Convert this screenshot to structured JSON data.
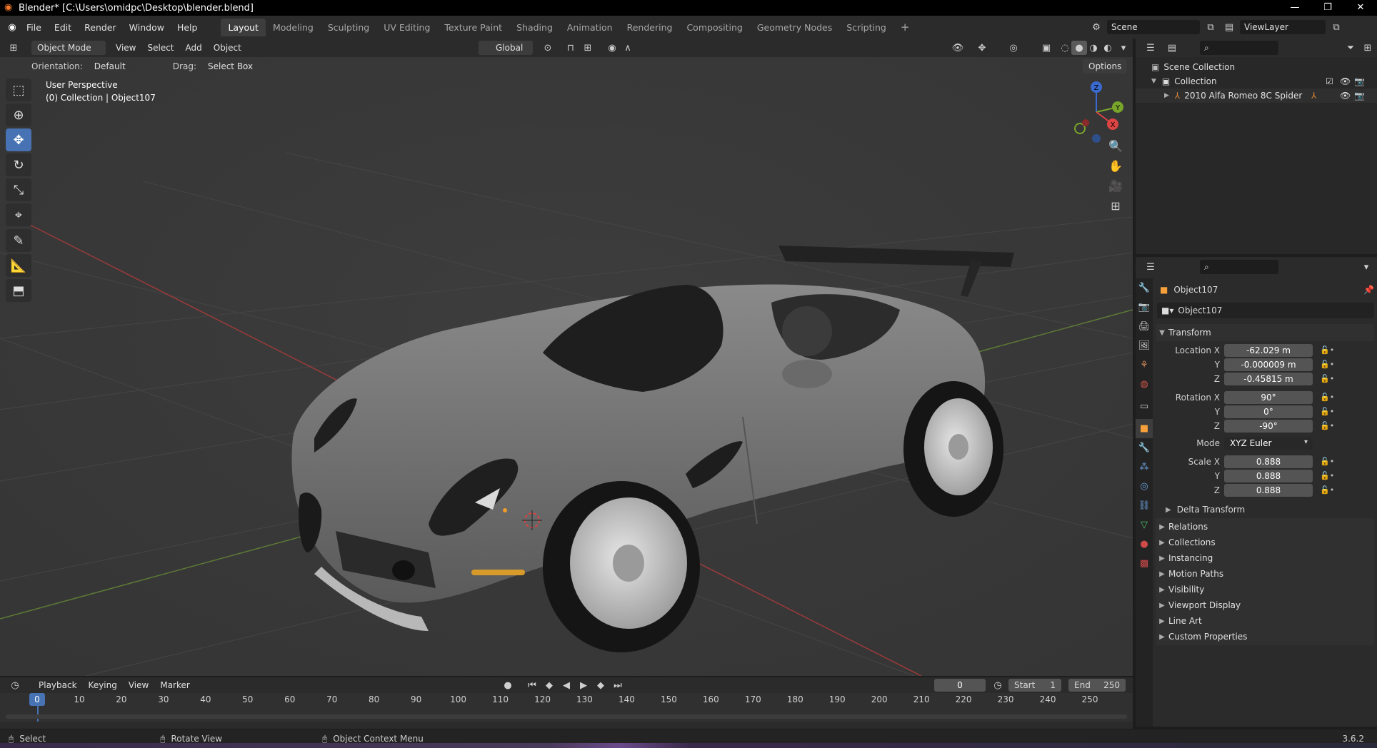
{
  "window": {
    "title": "Blender* [C:\\Users\\omidpc\\Desktop\\blender.blend]",
    "controls": [
      "—",
      "❐",
      "✕"
    ]
  },
  "menubar": {
    "menus": [
      "File",
      "Edit",
      "Render",
      "Window",
      "Help"
    ],
    "workspaces": [
      "Layout",
      "Modeling",
      "Sculpting",
      "UV Editing",
      "Texture Paint",
      "Shading",
      "Animation",
      "Rendering",
      "Compositing",
      "Geometry Nodes",
      "Scripting"
    ],
    "active_workspace": "Layout",
    "add_workspace": "+",
    "scene": "Scene",
    "view_layer": "ViewLayer"
  },
  "viewport": {
    "mode": "Object Mode",
    "menus": [
      "View",
      "Select",
      "Add",
      "Object"
    ],
    "transform_orientation": "Global",
    "orientation_label": "Orientation:",
    "orientation_value": "Default",
    "drag_label": "Drag:",
    "drag_value": "Select Box",
    "options": "Options",
    "overlay_line1": "User Perspective",
    "overlay_line2": "(0) Collection | Object107",
    "gizmo_axes": [
      "Z",
      "Y",
      "X"
    ]
  },
  "outliner": {
    "rows": [
      {
        "label": "Scene Collection"
      },
      {
        "label": "Collection"
      },
      {
        "label": "2010 Alfa Romeo 8C Spider"
      }
    ]
  },
  "properties": {
    "object_name": "Object107",
    "data_name": "Object107",
    "transform_title": "Transform",
    "location_label": "Location X",
    "location": [
      "-62.029 m",
      "-0.000009 m",
      "-0.45815 m"
    ],
    "rotation_label": "Rotation X",
    "rotation": [
      "90°",
      "0°",
      "-90°"
    ],
    "mode_label": "Mode",
    "mode_value": "XYZ Euler",
    "scale_label": "Scale X",
    "scale": [
      "0.888",
      "0.888",
      "0.888"
    ],
    "axis_y": "Y",
    "axis_z": "Z",
    "delta_transform": "Delta Transform",
    "panels": [
      "Relations",
      "Collections",
      "Instancing",
      "Motion Paths",
      "Visibility",
      "Viewport Display",
      "Line Art",
      "Custom Properties"
    ]
  },
  "timeline": {
    "menus": [
      "Playback",
      "Keying",
      "View",
      "Marker"
    ],
    "current_frame": "0",
    "start_label": "Start",
    "start": "1",
    "end_label": "End",
    "end": "250",
    "ticks": [
      "0",
      "10",
      "20",
      "30",
      "40",
      "50",
      "60",
      "70",
      "80",
      "90",
      "100",
      "110",
      "120",
      "130",
      "140",
      "150",
      "160",
      "170",
      "180",
      "190",
      "200",
      "210",
      "220",
      "230",
      "240",
      "250"
    ]
  },
  "statusbar": {
    "select": "Select",
    "rotate": "Rotate View",
    "context": "Object Context Menu",
    "version": "3.6.2"
  }
}
